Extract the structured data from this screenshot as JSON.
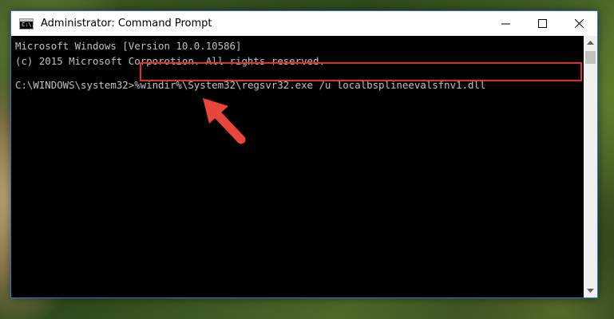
{
  "window": {
    "title": "Administrator: Command Prompt",
    "icon_text": "C:\\.",
    "controls": {
      "minimize_icon": "minimize-icon",
      "maximize_icon": "maximize-icon",
      "close_icon": "close-icon"
    }
  },
  "console": {
    "lines": [
      "Microsoft Windows [Version 10.0.10586]",
      "(c) 2015 Microsoft Corporotion. All rights reserved."
    ],
    "prompt": "C:\\WINDOWS\\system32>",
    "command": "%windir%\\System32\\regsvr32.exe /u localbsplineevalsfnv1.dll"
  },
  "colors": {
    "console_bg": "#000000",
    "console_text": "#c0c0c0",
    "highlight": "#d9342c",
    "arrow": "#e8463c",
    "window_border": "#2b76d2"
  }
}
